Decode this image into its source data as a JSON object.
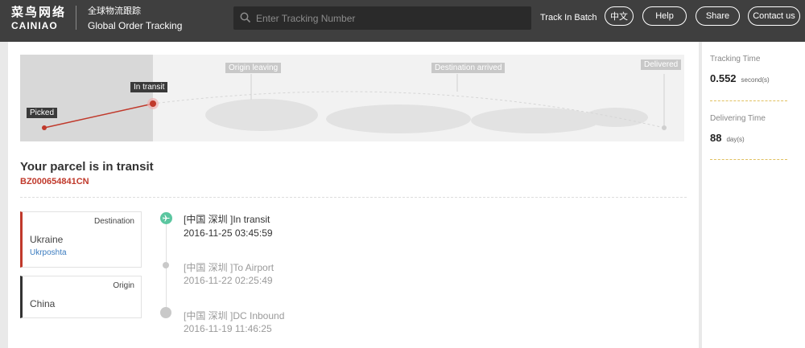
{
  "header": {
    "logo_cn": "菜鸟网络",
    "logo_en": "CAINIAO",
    "product_cn": "全球物流跟踪",
    "product_en": "Global Order Tracking",
    "search_placeholder": "Enter Tracking Number",
    "track_batch": "Track In Batch",
    "lang_button": "中文",
    "help_button": "Help",
    "share_button": "Share",
    "contact_button": "Contact us"
  },
  "progress": {
    "steps": [
      "Picked",
      "In transit",
      "Origin leaving",
      "Destination arrived",
      "Delivered"
    ],
    "current_step": 1
  },
  "parcel": {
    "status_title": "Your parcel is in transit",
    "tracking_number": "BZ000654841CN"
  },
  "destination": {
    "label": "Destination",
    "country": "Ukraine",
    "carrier": "Ukrposhta"
  },
  "origin": {
    "label": "Origin",
    "country": "China"
  },
  "events": [
    {
      "title": "[中国 深圳 ]In transit",
      "time": "2016-11-25 03:45:59"
    },
    {
      "title": "[中国 深圳 ]To Airport",
      "time": "2016-11-22 02:25:49"
    },
    {
      "title": "[中国 深圳 ]DC Inbound",
      "time": "2016-11-19 11:46:25"
    }
  ],
  "stats": {
    "tracking_time_label": "Tracking Time",
    "tracking_time_value": "0.552",
    "tracking_time_unit": "second(s)",
    "delivering_time_label": "Delivering Time",
    "delivering_time_value": "88",
    "delivering_time_unit": "day(s)"
  },
  "colors": {
    "header_bg": "#3f3f3f",
    "accent_red": "#c0392b",
    "active_green": "#5bc6a0",
    "link_blue": "#3a7bbf"
  }
}
